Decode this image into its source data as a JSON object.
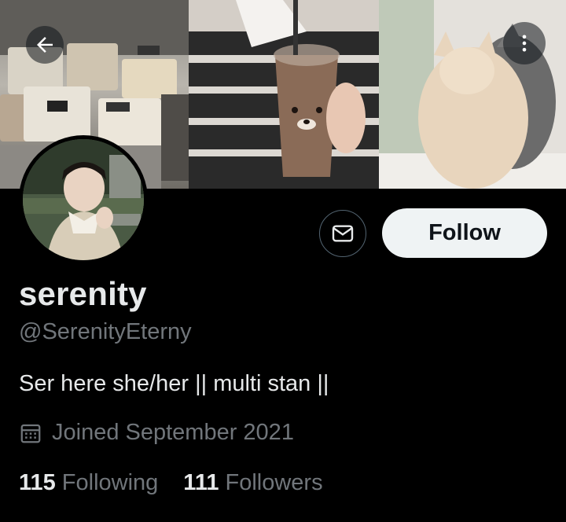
{
  "header": {
    "back_icon": "arrow-left-icon",
    "more_icon": "vertical-ellipsis-icon"
  },
  "profile": {
    "display_name": "serenity",
    "handle": "@SerenityEterny",
    "bio": "Ser here she/her || multi stan ||",
    "joined": "Joined September 2021",
    "joined_icon": "calendar-icon",
    "following_count": "115",
    "following_label": "Following",
    "followers_count": "111",
    "followers_label": "Followers"
  },
  "actions": {
    "message_icon": "envelope-icon",
    "follow_label": "Follow"
  },
  "colors": {
    "background": "#000000",
    "primary_text": "#e7e9ea",
    "secondary_text": "#71767b",
    "follow_button_bg": "#eff3f4",
    "follow_button_text": "#0f1419",
    "border": "#536471"
  }
}
